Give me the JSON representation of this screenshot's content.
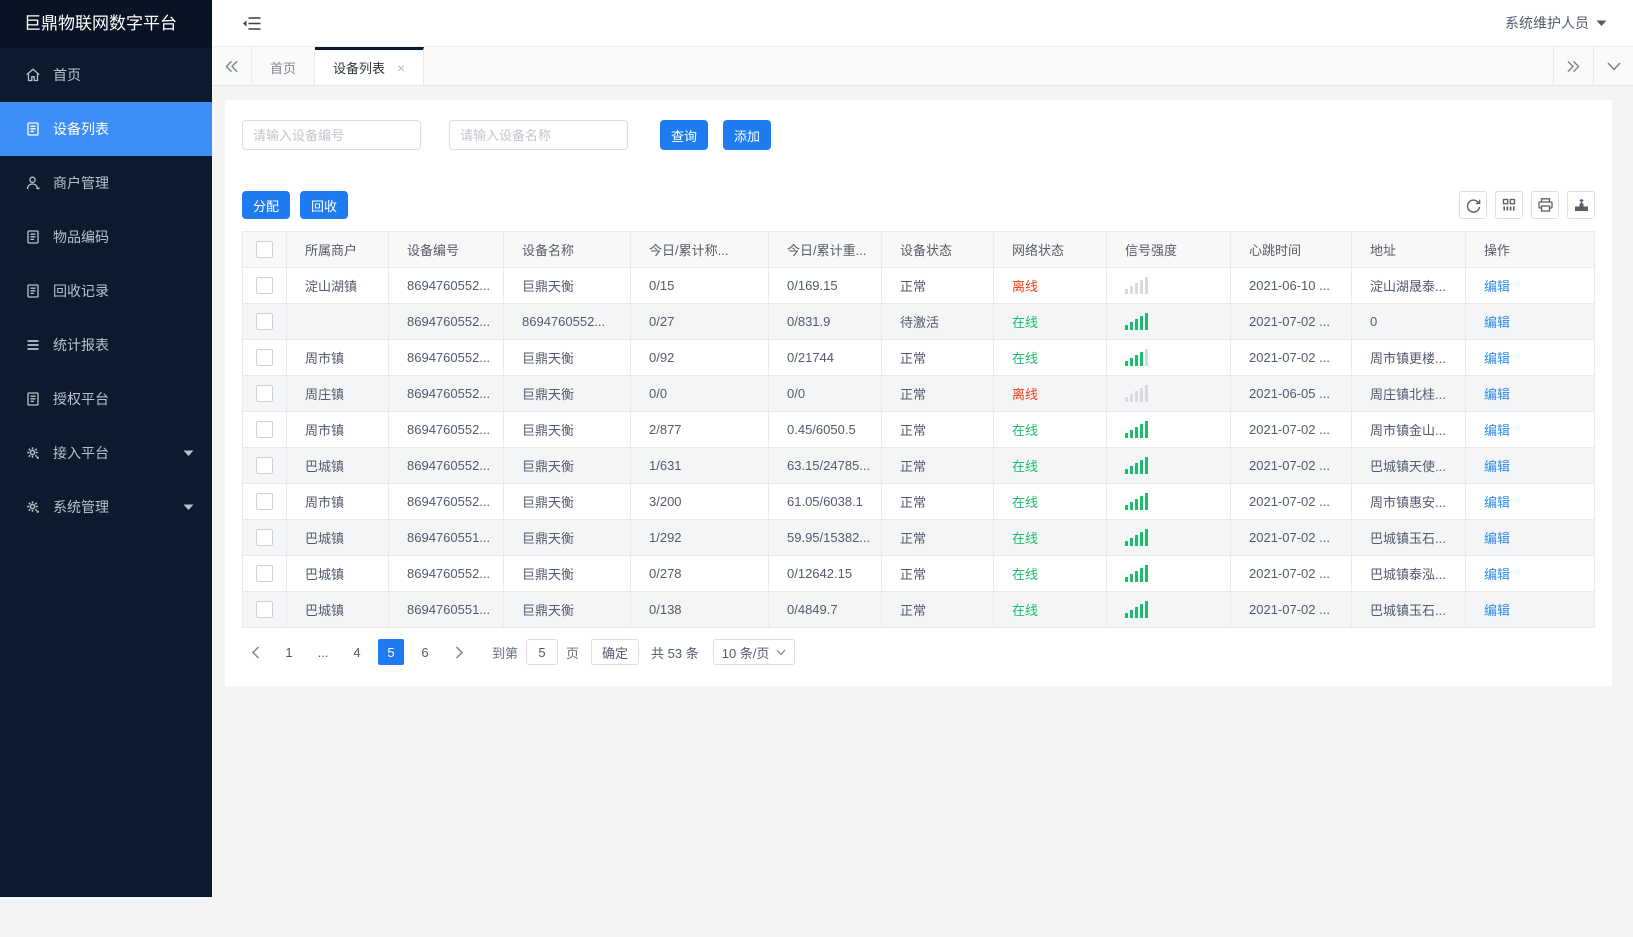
{
  "app": {
    "logo": "巨鼎物联网数字平台",
    "user_name": "系统维护人员"
  },
  "sidebar": {
    "items": [
      {
        "icon": "home-icon",
        "label": "首页",
        "active": false,
        "expandable": false
      },
      {
        "icon": "device-list-icon",
        "label": "设备列表",
        "active": true,
        "expandable": false
      },
      {
        "icon": "merchant-icon",
        "label": "商户管理",
        "active": false,
        "expandable": false
      },
      {
        "icon": "item-code-icon",
        "label": "物品编码",
        "active": false,
        "expandable": false
      },
      {
        "icon": "recycle-record-icon",
        "label": "回收记录",
        "active": false,
        "expandable": false
      },
      {
        "icon": "report-icon",
        "label": "统计报表",
        "active": false,
        "expandable": false
      },
      {
        "icon": "auth-platform-icon",
        "label": "授权平台",
        "active": false,
        "expandable": false
      },
      {
        "icon": "access-platform-icon",
        "label": "接入平台",
        "active": false,
        "expandable": true
      },
      {
        "icon": "system-manage-icon",
        "label": "系统管理",
        "active": false,
        "expandable": true
      }
    ]
  },
  "tabbar": {
    "tabs": [
      {
        "label": "首页",
        "active": false,
        "closable": false
      },
      {
        "label": "设备列表",
        "active": true,
        "closable": true
      }
    ]
  },
  "search": {
    "device_no_placeholder": "请输入设备编号",
    "device_name_placeholder": "请输入设备名称",
    "query_label": "查询",
    "add_label": "添加"
  },
  "toolbar": {
    "assign_label": "分配",
    "recycle_label": "回收",
    "icons": [
      "refresh-icon",
      "columns-icon",
      "print-icon",
      "export-icon"
    ]
  },
  "table": {
    "headers": [
      "所属商户",
      "设备编号",
      "设备名称",
      "今日/累计称...",
      "今日/累计重...",
      "设备状态",
      "网络状态",
      "信号强度",
      "心跳时间",
      "地址",
      "操作"
    ],
    "rows": [
      {
        "merchant": "淀山湖镇",
        "device_no": "8694760552...",
        "device_name": "巨鼎天衡",
        "today_count": "0/15",
        "today_weight": "0/169.15",
        "device_status": "正常",
        "network_status": "离线",
        "signal": 0,
        "heartbeat": "2021-06-10 ...",
        "address": "淀山湖晟泰...",
        "action": "编辑"
      },
      {
        "merchant": "",
        "device_no": "8694760552...",
        "device_name": "8694760552...",
        "today_count": "0/27",
        "today_weight": "0/831.9",
        "device_status": "待激活",
        "network_status": "在线",
        "signal": 5,
        "heartbeat": "2021-07-02 ...",
        "address": "0",
        "action": "编辑"
      },
      {
        "merchant": "周市镇",
        "device_no": "8694760552...",
        "device_name": "巨鼎天衡",
        "today_count": "0/92",
        "today_weight": "0/21744",
        "device_status": "正常",
        "network_status": "在线",
        "signal": 4,
        "heartbeat": "2021-07-02 ...",
        "address": "周市镇更楼...",
        "action": "编辑"
      },
      {
        "merchant": "周庄镇",
        "device_no": "8694760552...",
        "device_name": "巨鼎天衡",
        "today_count": "0/0",
        "today_weight": "0/0",
        "device_status": "正常",
        "network_status": "离线",
        "signal": 0,
        "heartbeat": "2021-06-05 ...",
        "address": "周庄镇北桂...",
        "action": "编辑"
      },
      {
        "merchant": "周市镇",
        "device_no": "8694760552...",
        "device_name": "巨鼎天衡",
        "today_count": "2/877",
        "today_weight": "0.45/6050.5",
        "device_status": "正常",
        "network_status": "在线",
        "signal": 5,
        "heartbeat": "2021-07-02 ...",
        "address": "周市镇金山...",
        "action": "编辑"
      },
      {
        "merchant": "巴城镇",
        "device_no": "8694760552...",
        "device_name": "巨鼎天衡",
        "today_count": "1/631",
        "today_weight": "63.15/24785...",
        "device_status": "正常",
        "network_status": "在线",
        "signal": 5,
        "heartbeat": "2021-07-02 ...",
        "address": "巴城镇天使...",
        "action": "编辑"
      },
      {
        "merchant": "周市镇",
        "device_no": "8694760552...",
        "device_name": "巨鼎天衡",
        "today_count": "3/200",
        "today_weight": "61.05/6038.1",
        "device_status": "正常",
        "network_status": "在线",
        "signal": 5,
        "heartbeat": "2021-07-02 ...",
        "address": "周市镇惠安...",
        "action": "编辑"
      },
      {
        "merchant": "巴城镇",
        "device_no": "8694760551...",
        "device_name": "巨鼎天衡",
        "today_count": "1/292",
        "today_weight": "59.95/15382...",
        "device_status": "正常",
        "network_status": "在线",
        "signal": 5,
        "heartbeat": "2021-07-02 ...",
        "address": "巴城镇玉石...",
        "action": "编辑"
      },
      {
        "merchant": "巴城镇",
        "device_no": "8694760552...",
        "device_name": "巨鼎天衡",
        "today_count": "0/278",
        "today_weight": "0/12642.15",
        "device_status": "正常",
        "network_status": "在线",
        "signal": 5,
        "heartbeat": "2021-07-02 ...",
        "address": "巴城镇泰泓...",
        "action": "编辑"
      },
      {
        "merchant": "巴城镇",
        "device_no": "8694760551...",
        "device_name": "巨鼎天衡",
        "today_count": "0/138",
        "today_weight": "0/4849.7",
        "device_status": "正常",
        "network_status": "在线",
        "signal": 5,
        "heartbeat": "2021-07-02 ...",
        "address": "巴城镇玉石...",
        "action": "编辑"
      }
    ]
  },
  "pagination": {
    "pages": [
      "1",
      "...",
      "4",
      "5",
      "6"
    ],
    "current": "5",
    "jump_prefix": "到第",
    "jump_value": "5",
    "jump_suffix": "页",
    "confirm_label": "确定",
    "total_text": "共 53 条",
    "page_size": "10 条/页"
  },
  "colors": {
    "accent": "#1e7bf0",
    "sidebar_active": "#3d8ef7",
    "online_green": "#19be6b",
    "offline_red": "#ed3f14",
    "link_blue": "#2d8cf0"
  }
}
